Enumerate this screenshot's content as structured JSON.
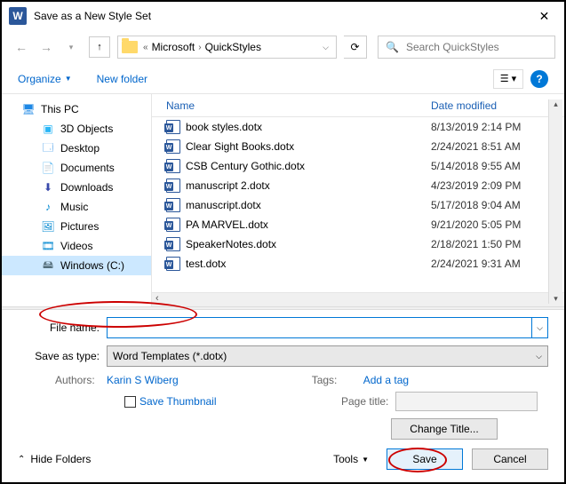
{
  "title": "Save as a New Style Set",
  "breadcrumb": [
    "Microsoft",
    "QuickStyles"
  ],
  "search_placeholder": "Search QuickStyles",
  "toolbar": {
    "organize": "Organize",
    "new_folder": "New folder"
  },
  "sidebar": {
    "items": [
      {
        "label": "This PC",
        "icon": "🖥"
      },
      {
        "label": "3D Objects",
        "icon": "▣"
      },
      {
        "label": "Desktop",
        "icon": "🗔"
      },
      {
        "label": "Documents",
        "icon": "📄"
      },
      {
        "label": "Downloads",
        "icon": "⬇"
      },
      {
        "label": "Music",
        "icon": "♪"
      },
      {
        "label": "Pictures",
        "icon": "🖼"
      },
      {
        "label": "Videos",
        "icon": "🎞"
      },
      {
        "label": "Windows (C:)",
        "icon": "🖴"
      }
    ]
  },
  "columns": {
    "name": "Name",
    "date": "Date modified"
  },
  "files": [
    {
      "name": "book styles.dotx",
      "date": "8/13/2019 2:14 PM"
    },
    {
      "name": "Clear Sight Books.dotx",
      "date": "2/24/2021 8:51 AM"
    },
    {
      "name": "CSB Century Gothic.dotx",
      "date": "5/14/2018 9:55 AM"
    },
    {
      "name": "manuscript 2.dotx",
      "date": "4/23/2019 2:09 PM"
    },
    {
      "name": "manuscript.dotx",
      "date": "5/17/2018 9:04 AM"
    },
    {
      "name": "PA MARVEL.dotx",
      "date": "9/21/2020 5:05 PM"
    },
    {
      "name": "SpeakerNotes.dotx",
      "date": "2/18/2021 1:50 PM"
    },
    {
      "name": "test.dotx",
      "date": "2/24/2021 9:31 AM"
    }
  ],
  "form": {
    "filename_label": "File name:",
    "filename_value": "",
    "type_label": "Save as type:",
    "type_value": "Word Templates (*.dotx)",
    "authors_label": "Authors:",
    "authors_value": "Karin S Wiberg",
    "tags_label": "Tags:",
    "tags_value": "Add a tag",
    "thumb_label": "Save Thumbnail",
    "pagetitle_label": "Page title:",
    "change_title": "Change Title..."
  },
  "footer": {
    "hide_folders": "Hide Folders",
    "tools": "Tools",
    "save": "Save",
    "cancel": "Cancel"
  }
}
